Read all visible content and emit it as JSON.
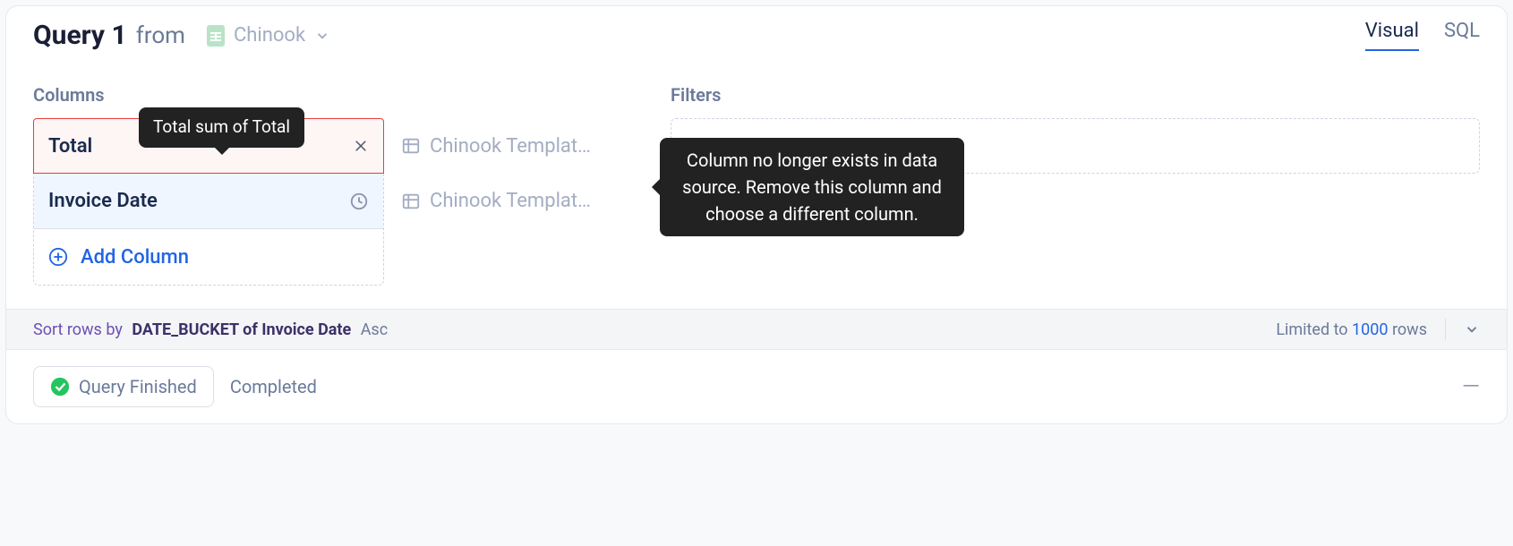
{
  "header": {
    "title": "Query 1",
    "from_label": "from",
    "source_name": "Chinook",
    "icon": "spreadsheet-icon"
  },
  "tabs": [
    {
      "label": "Visual",
      "active": true
    },
    {
      "label": "SQL",
      "active": false
    }
  ],
  "columns_section": {
    "label": "Columns",
    "add_label": "Add Column",
    "items": [
      {
        "label": "Total",
        "state": "error",
        "icon": "close-icon",
        "template": "Chinook Templat…"
      },
      {
        "label": "Invoice Date",
        "state": "normal",
        "icon": "clock-icon",
        "template": "Chinook Templat…"
      }
    ]
  },
  "filters_section": {
    "label": "Filters"
  },
  "tooltips": {
    "total_sum": "Total sum of Total",
    "missing_column": "Column no longer exists in data source. Remove this column and choose a different column."
  },
  "sort_bar": {
    "lead": "Sort rows by",
    "sort_expr": "DATE_BUCKET of Invoice Date",
    "direction": "Asc",
    "limit_prefix": "Limited to",
    "limit_count": "1000",
    "limit_suffix": "rows"
  },
  "status": {
    "pill": "Query Finished",
    "text": "Completed"
  }
}
